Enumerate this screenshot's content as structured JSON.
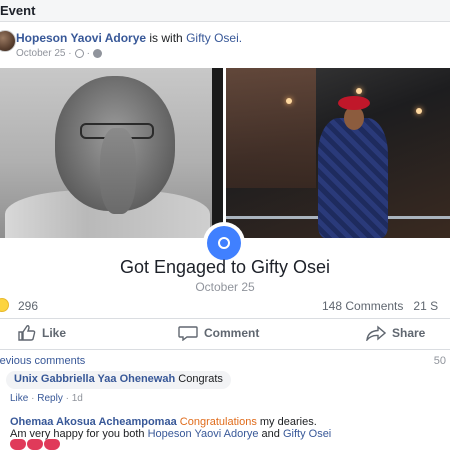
{
  "topbar": {
    "title": "Event"
  },
  "post": {
    "author": "Hopeson Yaovi Adorye",
    "with_text": "is with",
    "tagged": "Gifty Osei.",
    "date": "October 25 ·"
  },
  "event": {
    "title": "Got Engaged to Gifty Osei",
    "date": "October 25",
    "icon": "ring-icon",
    "accent": "#4080ff"
  },
  "stats": {
    "reaction_icon": "wow-icon",
    "reactions": "296",
    "comments": "148 Comments",
    "shares": "21 S"
  },
  "actions": {
    "like": "Like",
    "comment": "Comment",
    "share": "Share"
  },
  "comments": {
    "previous_label": "revious comments",
    "previous_count": "50",
    "items": [
      {
        "author": "Unix Gabbriella Yaa Ohenewah",
        "text": "Congrats",
        "like": "Like",
        "reply": "Reply",
        "time": "1d"
      },
      {
        "author": "Ohemaa Akosua Acheampomaa",
        "highlight": "Congratulations",
        "text1": "my dearies.",
        "text2": "Am very happy for you both",
        "link1": "Hopeson Yaovi Adorye",
        "and": "and",
        "link2": "Gifty Osei"
      }
    ]
  },
  "colors": {
    "link": "#385898",
    "muted": "#90949c",
    "highlight": "#e06c1c",
    "heart": "#e03a5a"
  }
}
